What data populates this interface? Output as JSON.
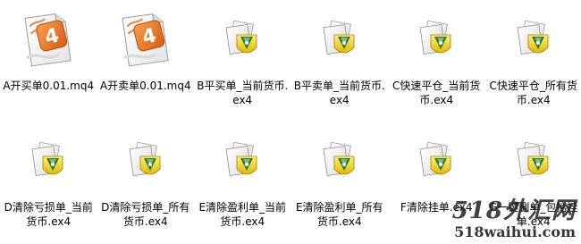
{
  "files": [
    {
      "name": "A开买单0.01.mq4",
      "icon": "mq4-source-icon"
    },
    {
      "name": "A开卖单0.01.mq4",
      "icon": "mq4-source-icon"
    },
    {
      "name": "B平买单_当前货币.ex4",
      "icon": "ex4-expert-icon"
    },
    {
      "name": "B平卖单_当前货币.ex4",
      "icon": "ex4-expert-icon"
    },
    {
      "name": "C快速平仓_当前货币.ex4",
      "icon": "ex4-expert-icon"
    },
    {
      "name": "C快速平仓_所有货币.ex4",
      "icon": "ex4-expert-icon"
    },
    {
      "name": "D清除亏损单_当前货币.ex4",
      "icon": "ex4-expert-icon"
    },
    {
      "name": "D清除亏损单_所有货币.ex4",
      "icon": "ex4-expert-icon"
    },
    {
      "name": "E清除盈利单_当前货币.ex4",
      "icon": "ex4-expert-icon"
    },
    {
      "name": "E清除盈利单_所有货币.ex4",
      "icon": "ex4-expert-icon"
    },
    {
      "name": "F清除挂单.ex4",
      "icon": "ex4-expert-icon"
    },
    {
      "name": "G一键删单_包括挂单.ex4",
      "icon": "ex4-expert-icon"
    }
  ],
  "watermark": {
    "line1": "518外汇网",
    "line2": "518waihui.com"
  },
  "colors": {
    "mq4_page": "#ffffff",
    "mq4_accent": "#e86a1c",
    "ex4_page": "#f4f4f4",
    "ex4_badge": "#f3d21c",
    "ex4_stripe": "#1f7a3a"
  }
}
